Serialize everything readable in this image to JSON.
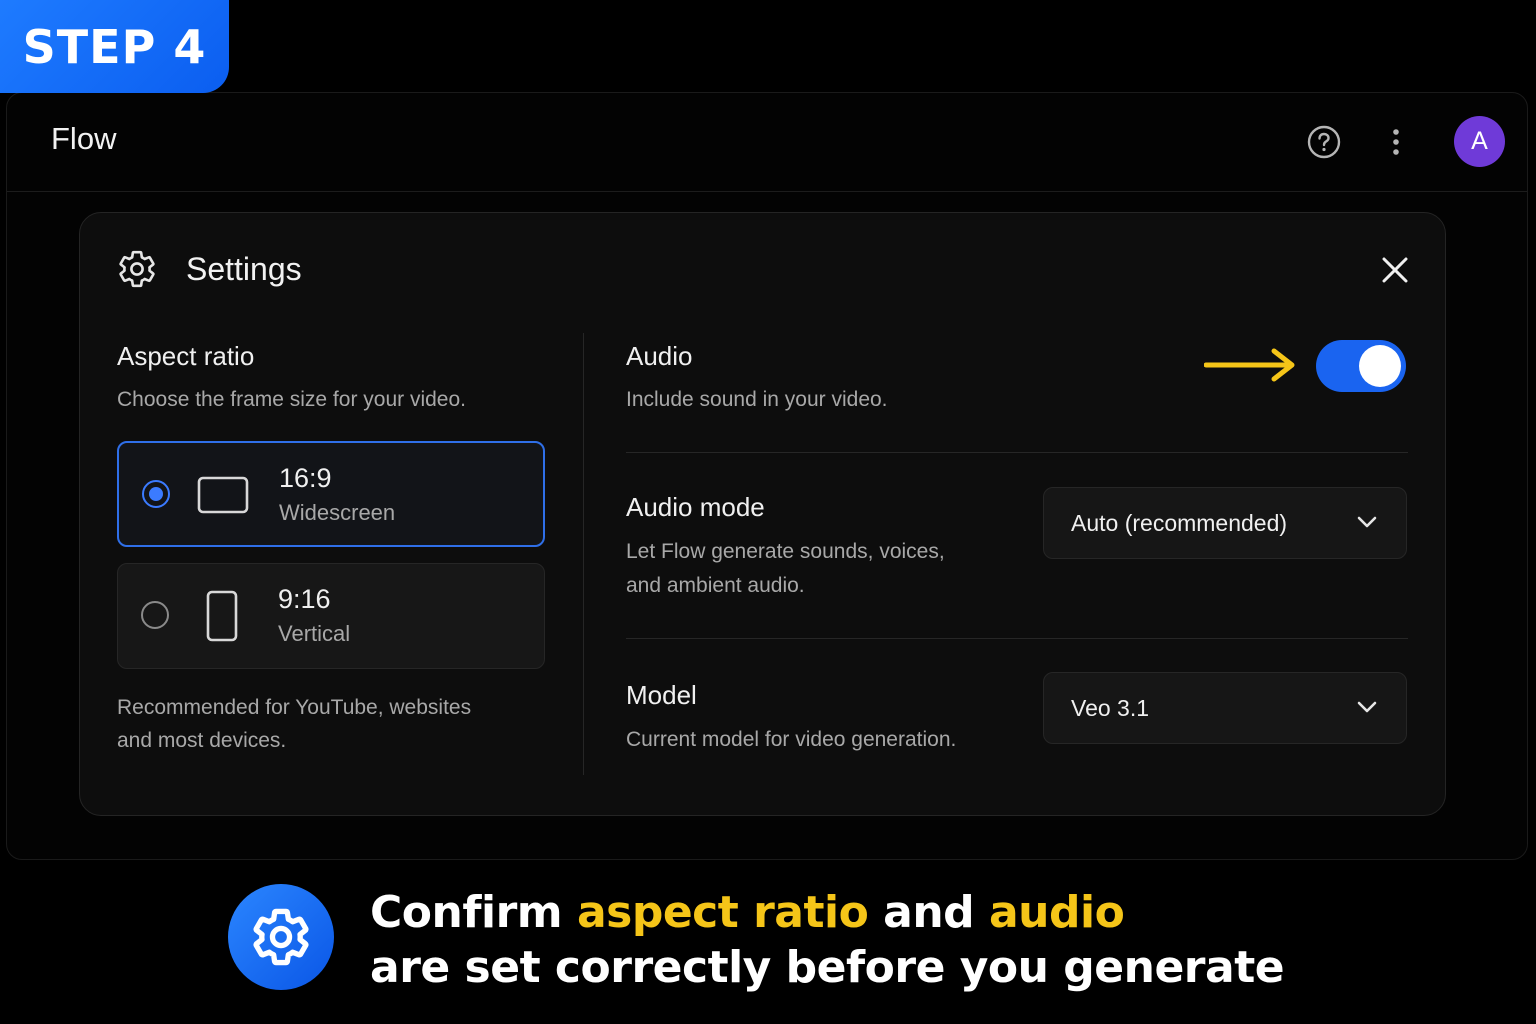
{
  "step_badge": "STEP 4",
  "header": {
    "app_title": "Flow",
    "avatar_initial": "A",
    "icons": [
      "help-icon",
      "more-vertical-icon"
    ]
  },
  "settings": {
    "title": "Settings",
    "aspect_ratio": {
      "title": "Aspect ratio",
      "description": "Choose the frame size for your video.",
      "options": [
        {
          "value": "16:9",
          "name": "Widescreen",
          "selected": true
        },
        {
          "value": "9:16",
          "name": "Vertical",
          "selected": false
        }
      ],
      "note_line1": "Recommended for YouTube, websites",
      "note_line2": "and most devices."
    },
    "audio": {
      "title": "Audio",
      "description": "Include sound in your video.",
      "enabled": true
    },
    "audio_mode": {
      "title": "Audio mode",
      "description_line1": "Let Flow generate sounds, voices,",
      "description_line2": "and ambient audio.",
      "selected": "Auto (recommended)"
    },
    "model": {
      "title": "Model",
      "description": "Current model for video generation.",
      "selected": "Veo 3.1"
    }
  },
  "caption": {
    "part1": "Confirm ",
    "highlight1": "aspect ratio",
    "part2": " and ",
    "highlight2": "audio",
    "line2": "are set correctly before you generate"
  },
  "colors": {
    "accent_blue": "#1a64f0",
    "highlight_yellow": "#f5c518",
    "avatar_purple": "#6f3ad8",
    "background": "#000000"
  }
}
